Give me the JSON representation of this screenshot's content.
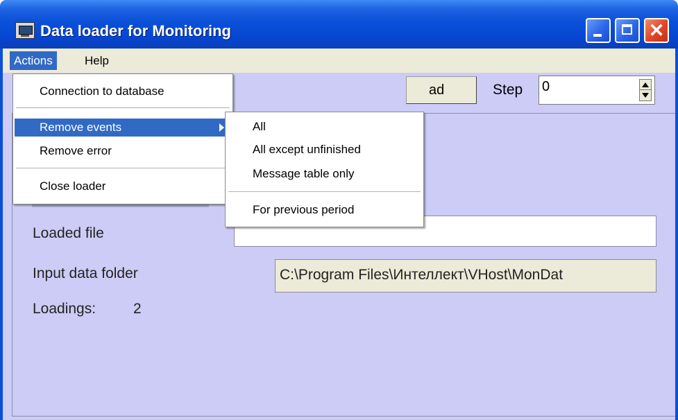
{
  "window": {
    "title": "Data loader for Monitoring"
  },
  "menubar": {
    "actions": "Actions",
    "help": "Help"
  },
  "actions_menu": {
    "connection": "Connection to database",
    "remove_events": "Remove events",
    "remove_error": "Remove error",
    "close_loader": "Close loader"
  },
  "remove_events_submenu": {
    "all": "All",
    "all_except_unfinished": "All except unfinished",
    "message_table_only": "Message table only",
    "for_previous_period": "For previous period"
  },
  "main": {
    "load_button_visible_text": "ad",
    "step_label": "Step",
    "step_value": "0",
    "loaded_file_label": "Loaded file",
    "loaded_file_value": "",
    "input_folder_label": "Input data folder",
    "input_folder_value": "C:\\Program Files\\Интеллект\\VHost\\MonDat",
    "loadings_label": "Loadings:",
    "loadings_value": "2"
  },
  "colors": {
    "titlebar": "#0a50d8",
    "client_background": "#ccccf6",
    "menu_highlight": "#316ac5",
    "close_button": "#e0452a"
  },
  "icons": {
    "app": "monitor-icon",
    "minimize": "minimize-icon",
    "maximize": "maximize-icon",
    "close": "close-icon",
    "submenu": "chevron-right-icon",
    "spin": "spin-arrows-icon"
  }
}
